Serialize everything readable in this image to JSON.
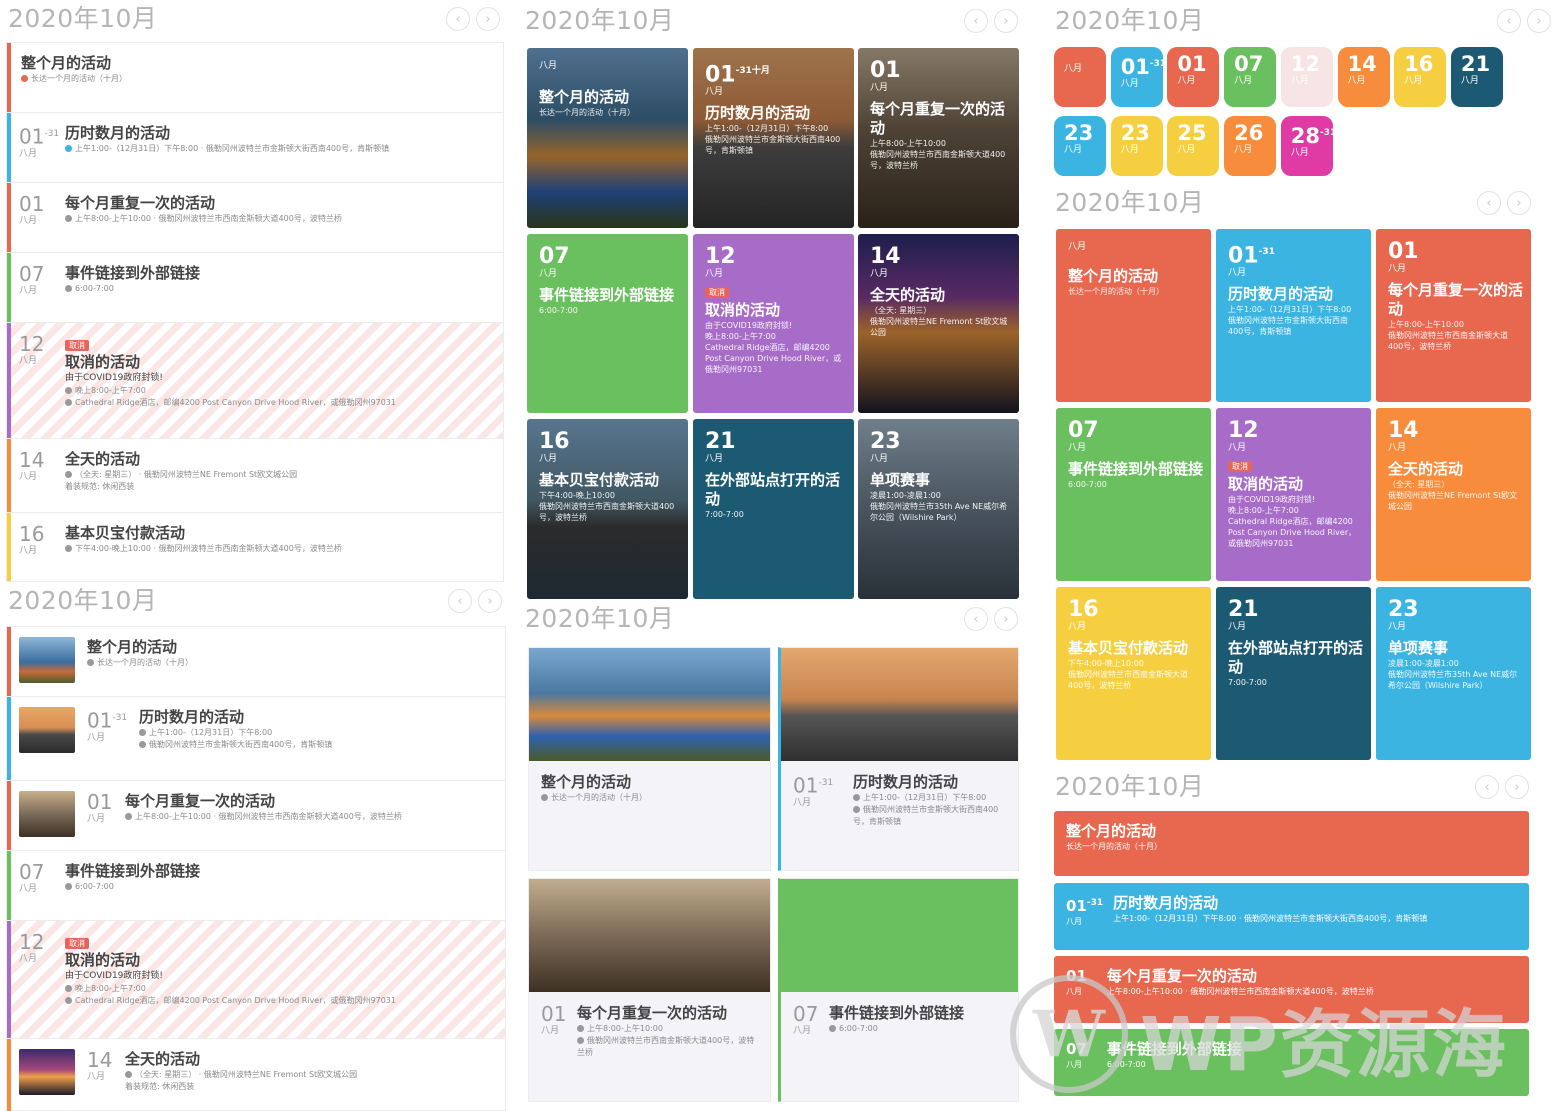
{
  "month_title": "2020年10月",
  "month_abbr": "八月",
  "month_oct": "十月",
  "nav": {
    "prev": "‹",
    "next": "›"
  },
  "colors": {
    "red": "#e8674f",
    "blue": "#3bb4e1",
    "green": "#6abf5e",
    "purple": "#a66cc8",
    "navy": "#1c5a73",
    "yellow": "#f6cf40",
    "orange": "#f68c3c",
    "pink": "#e03aa4",
    "cancel": "#e8645a"
  },
  "events": {
    "full_month": {
      "title": "整个月的活动",
      "sub": "长达一个月的活动（十月）"
    },
    "multi_day": {
      "day": "01",
      "end_day": "-31",
      "title": "历时数月的活动",
      "time": "上午1:00-（12月31日）下午8:00",
      "place": "俄勒冈州波特兰市金斯顿大街西南400号，肯斯顿镇"
    },
    "monthly": {
      "day": "01",
      "title": "每个月重复一次的活动",
      "time": "上午8:00-上午10:00",
      "place": "俄勒冈州波特兰市西南金斯顿大道400号，波特兰桥"
    },
    "external": {
      "day": "07",
      "title": "事件链接到外部链接",
      "time": "6:00-7:00"
    },
    "cancelled": {
      "day": "12",
      "badge": "取消",
      "title": "取消的活动",
      "reason": "由于COVID19政府封锁!",
      "time": "晚上8:00-上午7:00",
      "place": "Cathedral Ridge酒店，邮编4200 Post Canyon Drive Hood River，或俄勒冈州97031"
    },
    "all_day": {
      "day": "14",
      "title": "全天的活动",
      "time": "（全天: 星期三）",
      "place": "俄勒冈州波特兰NE Fremont St欧文城公园",
      "dress_label": "着装规范:",
      "dress": "休闲西装"
    },
    "payment": {
      "day": "16",
      "title": "基本贝宝付款活动",
      "time": "下午4:00-晚上10:00",
      "place": "俄勒冈州波特兰市西南金斯顿大道400号，波特兰桥"
    },
    "offsite": {
      "day": "21",
      "title": "在外部站点打开的活动",
      "time": "7:00-7:00"
    },
    "single": {
      "day": "23",
      "title": "单项赛事",
      "time": "凌晨1:00-凌晨1:00",
      "place": "俄勒冈州波特兰市35th Ave NE威尔希尔公园（Wilshire Park）"
    }
  },
  "squares": [
    {
      "day": "",
      "month": "八月",
      "color": "#e8674f"
    },
    {
      "day": "01",
      "sup": "-31",
      "sup_month": "十月",
      "month": "八月",
      "color": "#3bb4e1"
    },
    {
      "day": "01",
      "month": "八月",
      "color": "#e8674f"
    },
    {
      "day": "07",
      "month": "八月",
      "color": "#6abf5e"
    },
    {
      "day": "12",
      "month": "八月",
      "color": "#f7e5e5"
    },
    {
      "day": "14",
      "month": "八月",
      "color": "#f68c3c"
    },
    {
      "day": "16",
      "month": "八月",
      "color": "#f6cf40"
    },
    {
      "day": "21",
      "month": "八月",
      "color": "#1c5a73"
    },
    {
      "day": "23",
      "month": "八月",
      "color": "#3bb4e1"
    },
    {
      "day": "23",
      "month": "八月",
      "color": "#f6cf40"
    },
    {
      "day": "25",
      "month": "八月",
      "color": "#f6cf40"
    },
    {
      "day": "26",
      "month": "八月",
      "color": "#f68c3c"
    },
    {
      "day": "28",
      "sup": "-31",
      "month": "八月",
      "color": "#e03aa4"
    }
  ],
  "watermark": "WP资源海"
}
